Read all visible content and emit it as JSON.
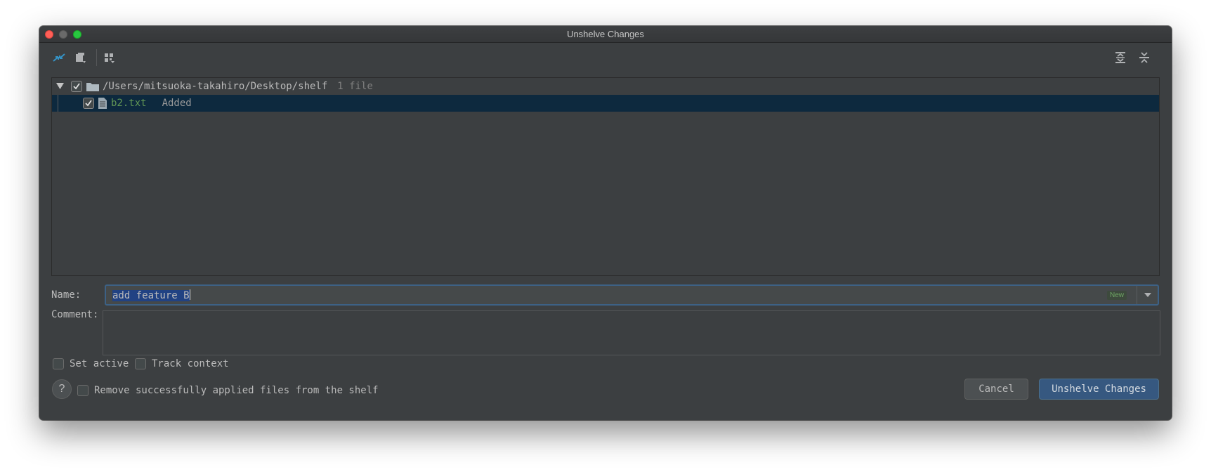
{
  "window": {
    "title": "Unshelve Changes"
  },
  "toolbar": {
    "left_icons": [
      "merge-arrows-icon",
      "move-to-changelist-icon",
      "group-by-icon"
    ],
    "right_icons": [
      "expand-all-icon",
      "collapse-all-icon"
    ]
  },
  "tree": {
    "root": {
      "path": "/Users/mitsuoka-takahiro/Desktop/shelf",
      "count": "1 file",
      "checked": true,
      "expanded": true
    },
    "files": [
      {
        "name": "b2.txt",
        "status": "Added",
        "checked": true,
        "selected": true
      }
    ]
  },
  "form": {
    "name_label": "Name:",
    "name_value": "add feature B",
    "name_badge": "New",
    "comment_label": "Comment:",
    "comment_value": ""
  },
  "options": {
    "set_active": "Set active",
    "track_context": "Track context",
    "remove_applied": "Remove successfully applied files from the shelf"
  },
  "buttons": {
    "help": "?",
    "cancel": "Cancel",
    "unshelve": "Unshelve Changes"
  },
  "colors": {
    "background": "#3c3f41",
    "selection": "#0d293e",
    "added_file": "#629755",
    "accent_blue": "#365880"
  }
}
